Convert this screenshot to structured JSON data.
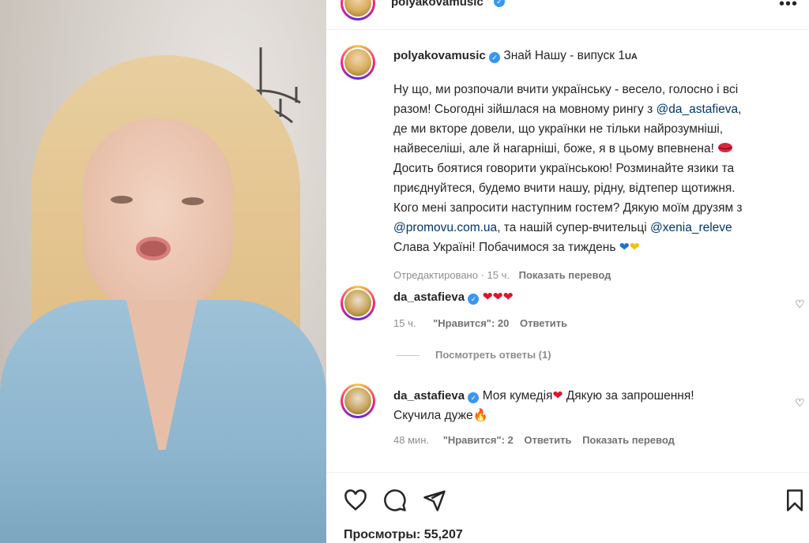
{
  "post": {
    "author": "polyakovamusic",
    "caption_title": "Знай Нашу - випуск 1",
    "caption_title_flag": "UA",
    "caption_lines": [
      "Ну що, ми розпочали вчити українську - весело, голосно і всі",
      "разом! Сьогодні зійшлася на мовному рингу з ",
      "@da_astafieva",
      ",",
      "де ми вкторе довели, що українки не тільки найрозумніші,",
      "найвеселіші, але й нагарніші, боже, я в цьому впевнена!",
      "Досить боятися говорити українською! Розминайте язики та",
      "приєднуйтеся, будемо вчити нашу, рідну, відтепер щотижня.",
      "Кого мені запросити наступним гостем? Дякую моїм друзям з",
      "@promovu.com.ua",
      ", та нашій супер-вчительці ",
      "@xenia_releve",
      "Слава Україні! Побачимося за тиждень"
    ],
    "edited_label": "Отредактировано",
    "edited_time": "15 ч.",
    "translate_label": "Показать перевод"
  },
  "comments": [
    {
      "author": "da_astafieva",
      "text": "",
      "time": "15 ч.",
      "likes": "\"Нравится\": 20",
      "reply": "Ответить"
    },
    {
      "author": "da_astafieva",
      "text": "Моя кумедія",
      "text2": " Дякую за запрошення!",
      "text3": "Скучила дуже",
      "time": "48 мин.",
      "likes": "\"Нравится\": 2",
      "reply": "Ответить",
      "translate": "Показать перевод"
    }
  ],
  "view_replies": "Посмотреть ответы (1)",
  "views_label": "Просмотры:",
  "views_count": "55,207",
  "colors": {
    "accent_link": "#00376b",
    "verified": "#3897f0",
    "muted": "#8e8e8e"
  },
  "icons": [
    "heart-icon",
    "comment-icon",
    "share-icon",
    "bookmark-icon",
    "verified-icon",
    "more-icon",
    "like-comment-icon"
  ]
}
